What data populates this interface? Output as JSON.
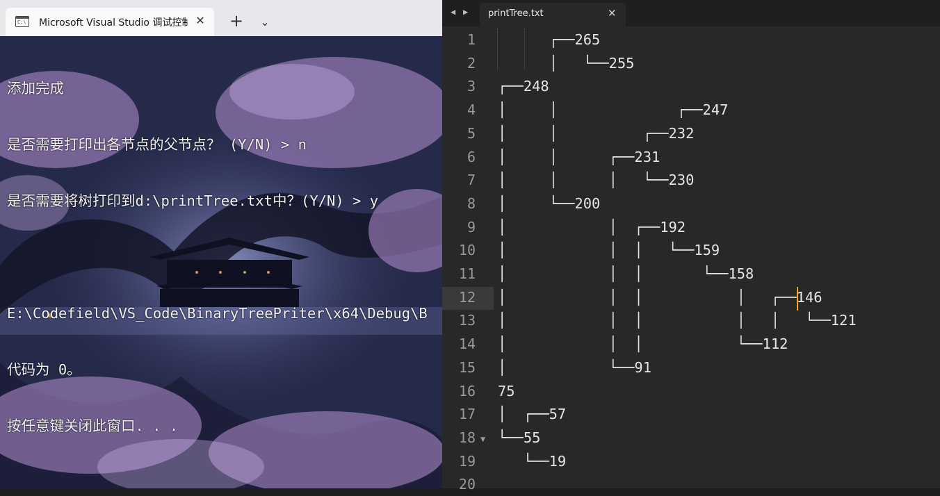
{
  "console": {
    "tab_title": "Microsoft Visual Studio 调试控制",
    "tab_icon_text": "C:\\",
    "new_tab_symbol": "+",
    "dropdown_symbol": "⌄",
    "close_symbol": "✕",
    "lines": [
      "添加完成",
      "是否需要打印出各节点的父节点？ (Y/N) > n",
      "是否需要将树打印到d:\\printTree.txt中？(Y/N) > y",
      "",
      "E:\\Codefield\\VS_Code\\BinaryTreePriter\\x64\\Debug\\B",
      "代码为 0。",
      "按任意键关闭此窗口. . ."
    ]
  },
  "editor": {
    "nav_prev": "◀",
    "nav_next": "▶",
    "file_name": "printTree.txt",
    "close_symbol": "✕",
    "current_line": 12,
    "fold_marker": "▼",
    "line_numbers": [
      "1",
      "2",
      "3",
      "4",
      "5",
      "6",
      "7",
      "8",
      "9",
      "10",
      "11",
      "12",
      "13",
      "14",
      "15",
      "16",
      "17",
      "18",
      "19",
      "20"
    ],
    "lines": [
      "      ┌──265",
      "      │   └──255",
      "┌──248",
      "│     │              ┌──247",
      "│     │          ┌──232",
      "│     │      ┌──231",
      "│     │      │   └──230",
      "│     └──200",
      "│            │  ┌──192",
      "│            │  │   └──159",
      "│            │  │       └──158",
      "│            │  │           │   ┌──146",
      "│            │  │           │   │   └──121",
      "│            │  │           └──112",
      "│            └──91",
      "75",
      "│  ┌──57",
      "└──55",
      "   └──19",
      ""
    ]
  },
  "colors": {
    "editor_bg": "#282828",
    "editor_text": "#e6e6e6",
    "line_number": "#9a9a9a",
    "cursor": "#f5a623",
    "console_text": "#f2f2f2"
  }
}
